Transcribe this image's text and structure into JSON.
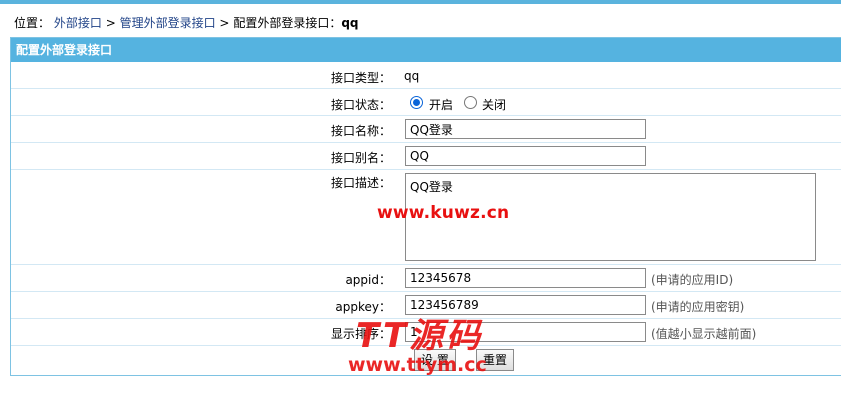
{
  "breadcrumb": {
    "prefix": "位置：",
    "items": [
      "外部接口",
      "管理外部登录接口"
    ],
    "sep": ">",
    "current_label": "配置外部登录接口：",
    "current_value": "qq"
  },
  "panel": {
    "title": "配置外部登录接口"
  },
  "form": {
    "type_label": "接口类型：",
    "type_value": "qq",
    "status_label": "接口状态：",
    "status_on": "开启",
    "status_off": "关闭",
    "status_selected": "开启",
    "name_label": "接口名称：",
    "name_value": "QQ登录",
    "alias_label": "接口别名：",
    "alias_value": "QQ",
    "desc_label": "接口描述：",
    "desc_value": "QQ登录",
    "appid_label": "appid：",
    "appid_value": "12345678",
    "appid_hint": "(申请的应用ID)",
    "appkey_label": "appkey：",
    "appkey_value": "123456789",
    "appkey_hint": "(申请的应用密钥)",
    "order_label": "显示排序：",
    "order_value": "1",
    "order_hint": "(值越小显示越前面)"
  },
  "buttons": {
    "submit": "设 置",
    "reset": "重置"
  },
  "watermarks": {
    "url1": "www.kuwz.cn",
    "brand": "TT源码",
    "url2": "www.ttym.cc"
  },
  "colors": {
    "header_bg": "#55b3e0",
    "border": "#7ec3e3",
    "watermark": "#e81010"
  }
}
